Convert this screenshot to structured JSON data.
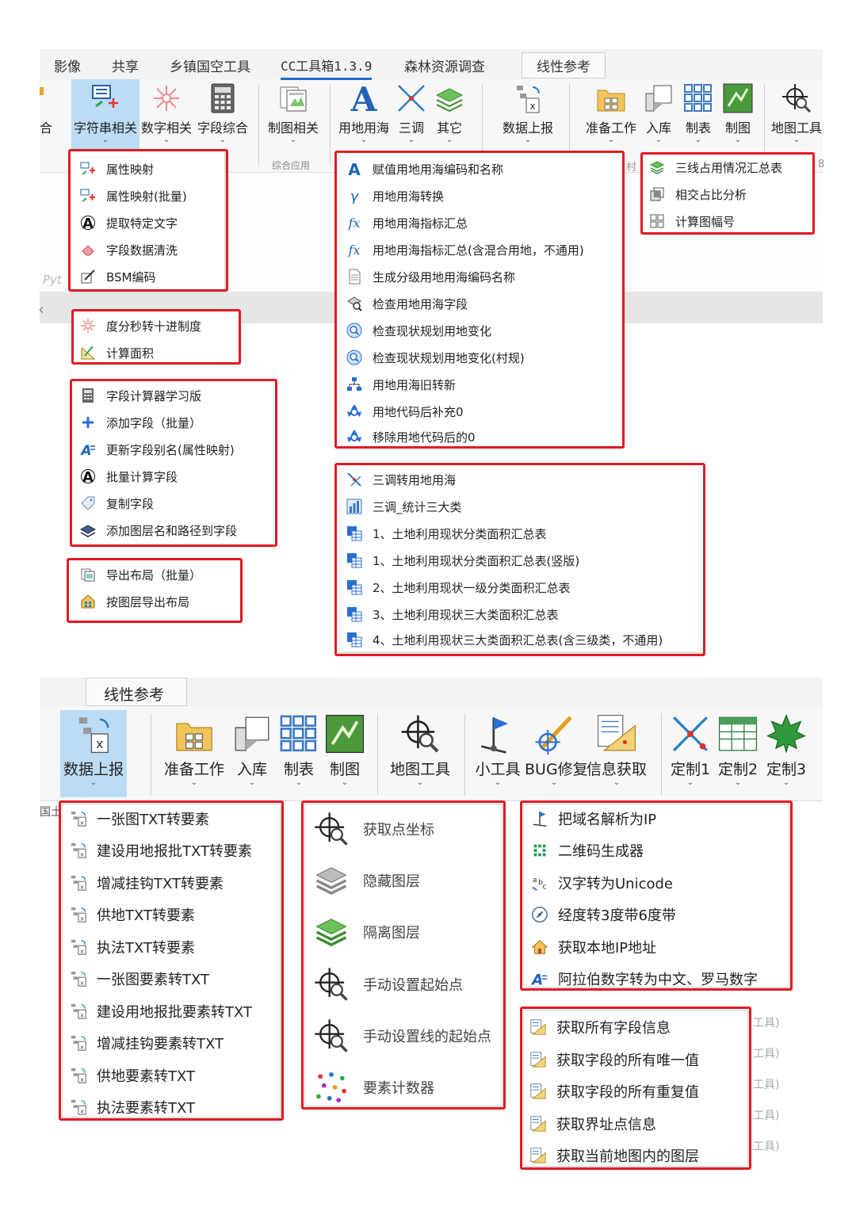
{
  "top": {
    "tabs": [
      "影像",
      "共享",
      "乡镇国空工具",
      "CC工具箱1.3.9",
      "森林资源调查",
      "线性参考"
    ],
    "ribbon": {
      "left_cut": "合",
      "buttons": [
        {
          "label": "字符串相关"
        },
        {
          "label": "数字相关"
        },
        {
          "label": "字段综合"
        },
        {
          "label": "制图相关"
        },
        {
          "label": "用地用海"
        },
        {
          "label": "三调"
        },
        {
          "label": "其它"
        },
        {
          "label": "数据上报"
        },
        {
          "label": "准备工作"
        },
        {
          "label": "入库"
        },
        {
          "label": "制表"
        },
        {
          "label": "制图"
        },
        {
          "label": "地图工具"
        }
      ],
      "group_label": "综合应用"
    },
    "bg_fragments": {
      "python": "Pyt",
      "arrow": "‹",
      "left_mark": "村",
      "right_mark": "8"
    },
    "menus": {
      "string": [
        "属性映射",
        "属性映射(批量)",
        "提取特定文字",
        "字段数据清洗",
        "BSM编码"
      ],
      "number": [
        "度分秒转十进制度",
        "计算面积"
      ],
      "field": [
        "字段计算器学习版",
        "添加字段（批量）",
        "更新字段别名(属性映射)",
        "批量计算字段",
        "复制字段",
        "添加图层名和路径到字段"
      ],
      "carto": [
        "导出布局（批量）",
        "按图层导出布局"
      ],
      "landuse": [
        "赋值用地用海编码和名称",
        "用地用海转换",
        "用地用海指标汇总",
        "用地用海指标汇总(含混合用地，不通用)",
        "生成分级用地用海编码名称",
        "检查用地用海字段",
        "检查现状规划用地变化",
        "检查现状规划用地变化(村规)",
        "用地用海旧转新",
        "用地代码后补充0",
        "移除用地代码后的0"
      ],
      "sandiao": [
        "三调转用地用海",
        "三调_统计三大类",
        "1、土地利用现状分类面积汇总表",
        "1、土地利用现状分类面积汇总表(竖版)",
        "2、土地利用现状一级分类面积汇总表",
        "3、土地利用现状三大类面积汇总表",
        "4、土地利用现状三大类面积汇总表(含三级类，不通用)"
      ],
      "other": [
        "三线占用情况汇总表",
        "相交占比分析",
        "计算图幅号"
      ]
    }
  },
  "bottom": {
    "tab": "线性参考",
    "left_cut": "国土",
    "ribbon": {
      "buttons": [
        {
          "label": "数据上报"
        },
        {
          "label": "准备工作"
        },
        {
          "label": "入库"
        },
        {
          "label": "制表"
        },
        {
          "label": "制图"
        },
        {
          "label": "地图工具"
        },
        {
          "label": "小工具"
        },
        {
          "label": "BUG修复"
        },
        {
          "label": "信息获取"
        },
        {
          "label": "定制1"
        },
        {
          "label": "定制2"
        },
        {
          "label": "定制3"
        }
      ]
    },
    "menus": {
      "report": [
        "一张图TXT转要素",
        "建设用地报批TXT转要素",
        "增减挂钩TXT转要素",
        "供地TXT转要素",
        "执法TXT转要素",
        "一张图要素转TXT",
        "建设用地报批要素转TXT",
        "增减挂钩要素转TXT",
        "供地要素转TXT",
        "执法要素转TXT"
      ],
      "maptools": [
        "获取点坐标",
        "隐藏图层",
        "隔离图层",
        "手动设置起始点",
        "手动设置线的起始点",
        "要素计数器"
      ],
      "small": [
        "把域名解析为IP",
        "二维码生成器",
        "汉字转为Unicode",
        "经度转3度带6度带",
        "获取本地IP地址",
        "阿拉伯数字转为中文、罗马数字"
      ],
      "info": [
        "获取所有字段信息",
        "获取字段的所有唯一值",
        "获取字段的所有重复值",
        "获取界址点信息",
        "获取当前地图内的图层"
      ],
      "right_fragments": [
        "工具)",
        "工具)",
        "工具)",
        "工具)",
        "工具)"
      ]
    }
  }
}
